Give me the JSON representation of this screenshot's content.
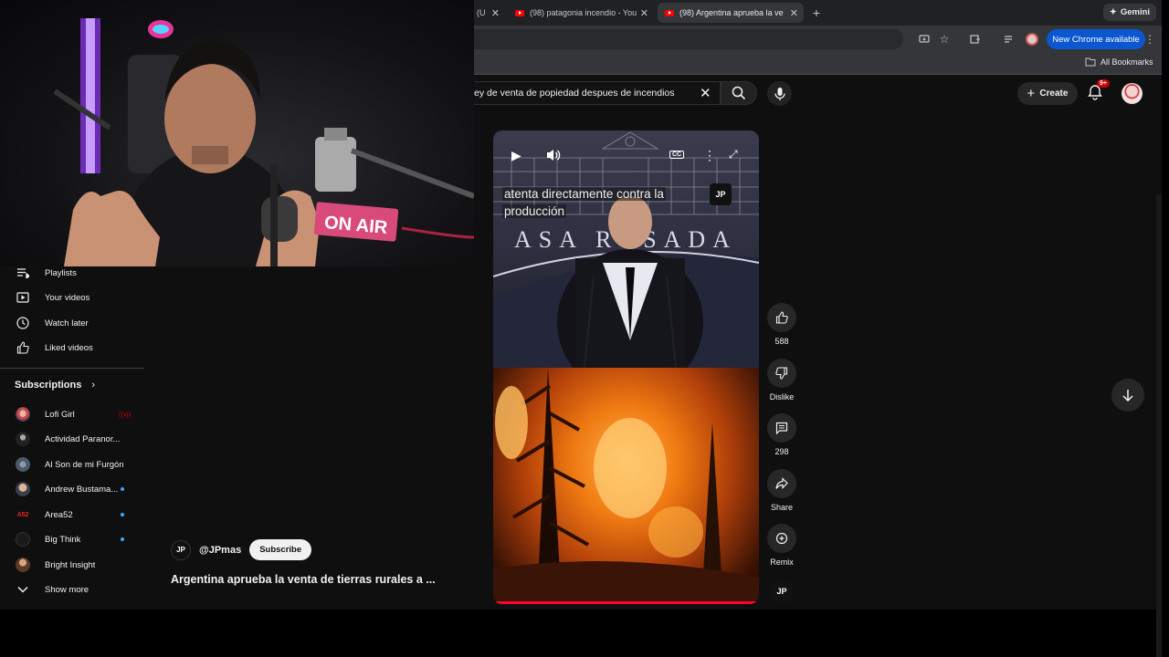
{
  "browser": {
    "tabs": [
      {
        "title": "(U",
        "active": false
      },
      {
        "title": "(98) patagonia incendio - You",
        "active": false
      },
      {
        "title": "(98) Argentina aprueba la ve",
        "active": true
      }
    ],
    "new_tab": "+",
    "gemini_label": "Gemini",
    "new_chrome_label": "New Chrome available",
    "bookmarks_label": "All Bookmarks"
  },
  "youtube": {
    "search_query": "ey de venta de popiedad despues de incendios",
    "create_label": "Create",
    "notifications_badge": "9+",
    "sidebar": {
      "you_items": [
        {
          "label": "Playlists",
          "icon": "playlists-icon"
        },
        {
          "label": "Your videos",
          "icon": "your-videos-icon"
        },
        {
          "label": "Watch later",
          "icon": "watch-later-icon"
        },
        {
          "label": "Liked videos",
          "icon": "liked-videos-icon"
        }
      ],
      "subscriptions_header": "Subscriptions",
      "subscriptions": [
        {
          "label": "Lofi Girl",
          "color": "#c94a4a",
          "live": true
        },
        {
          "label": "Actividad Paranor...",
          "color": "#222222",
          "live": false
        },
        {
          "label": "Al Son de mi Furgón",
          "color": "#4a5a6a",
          "live": false
        },
        {
          "label": "Andrew Bustama...",
          "color": "#6a4a3a",
          "live": true
        },
        {
          "label": "Area52",
          "color": "#c41a1a",
          "live": true
        },
        {
          "label": "Big Think",
          "color": "#1a1a1a",
          "live": false
        },
        {
          "label": "Bright Insight",
          "color": "#8a5a3a",
          "live": false
        }
      ],
      "show_more": "Show more"
    },
    "video": {
      "caption_line1": "atenta directamente contra la",
      "caption_line2": "producción",
      "overlay_text": "ASA ROSADA",
      "channel_handle": "@JPmas",
      "channel_logo": "JP",
      "subscribe_label": "Subscribe",
      "title": "Argentina aprueba la venta de tierras rurales a ...",
      "progress_fraction": 1.0
    },
    "actions": {
      "like_count": "588",
      "dislike_label": "Dislike",
      "comment_count": "298",
      "share_label": "Share",
      "remix_label": "Remix"
    },
    "webcam": {
      "sign_text": "ON AIR"
    }
  }
}
